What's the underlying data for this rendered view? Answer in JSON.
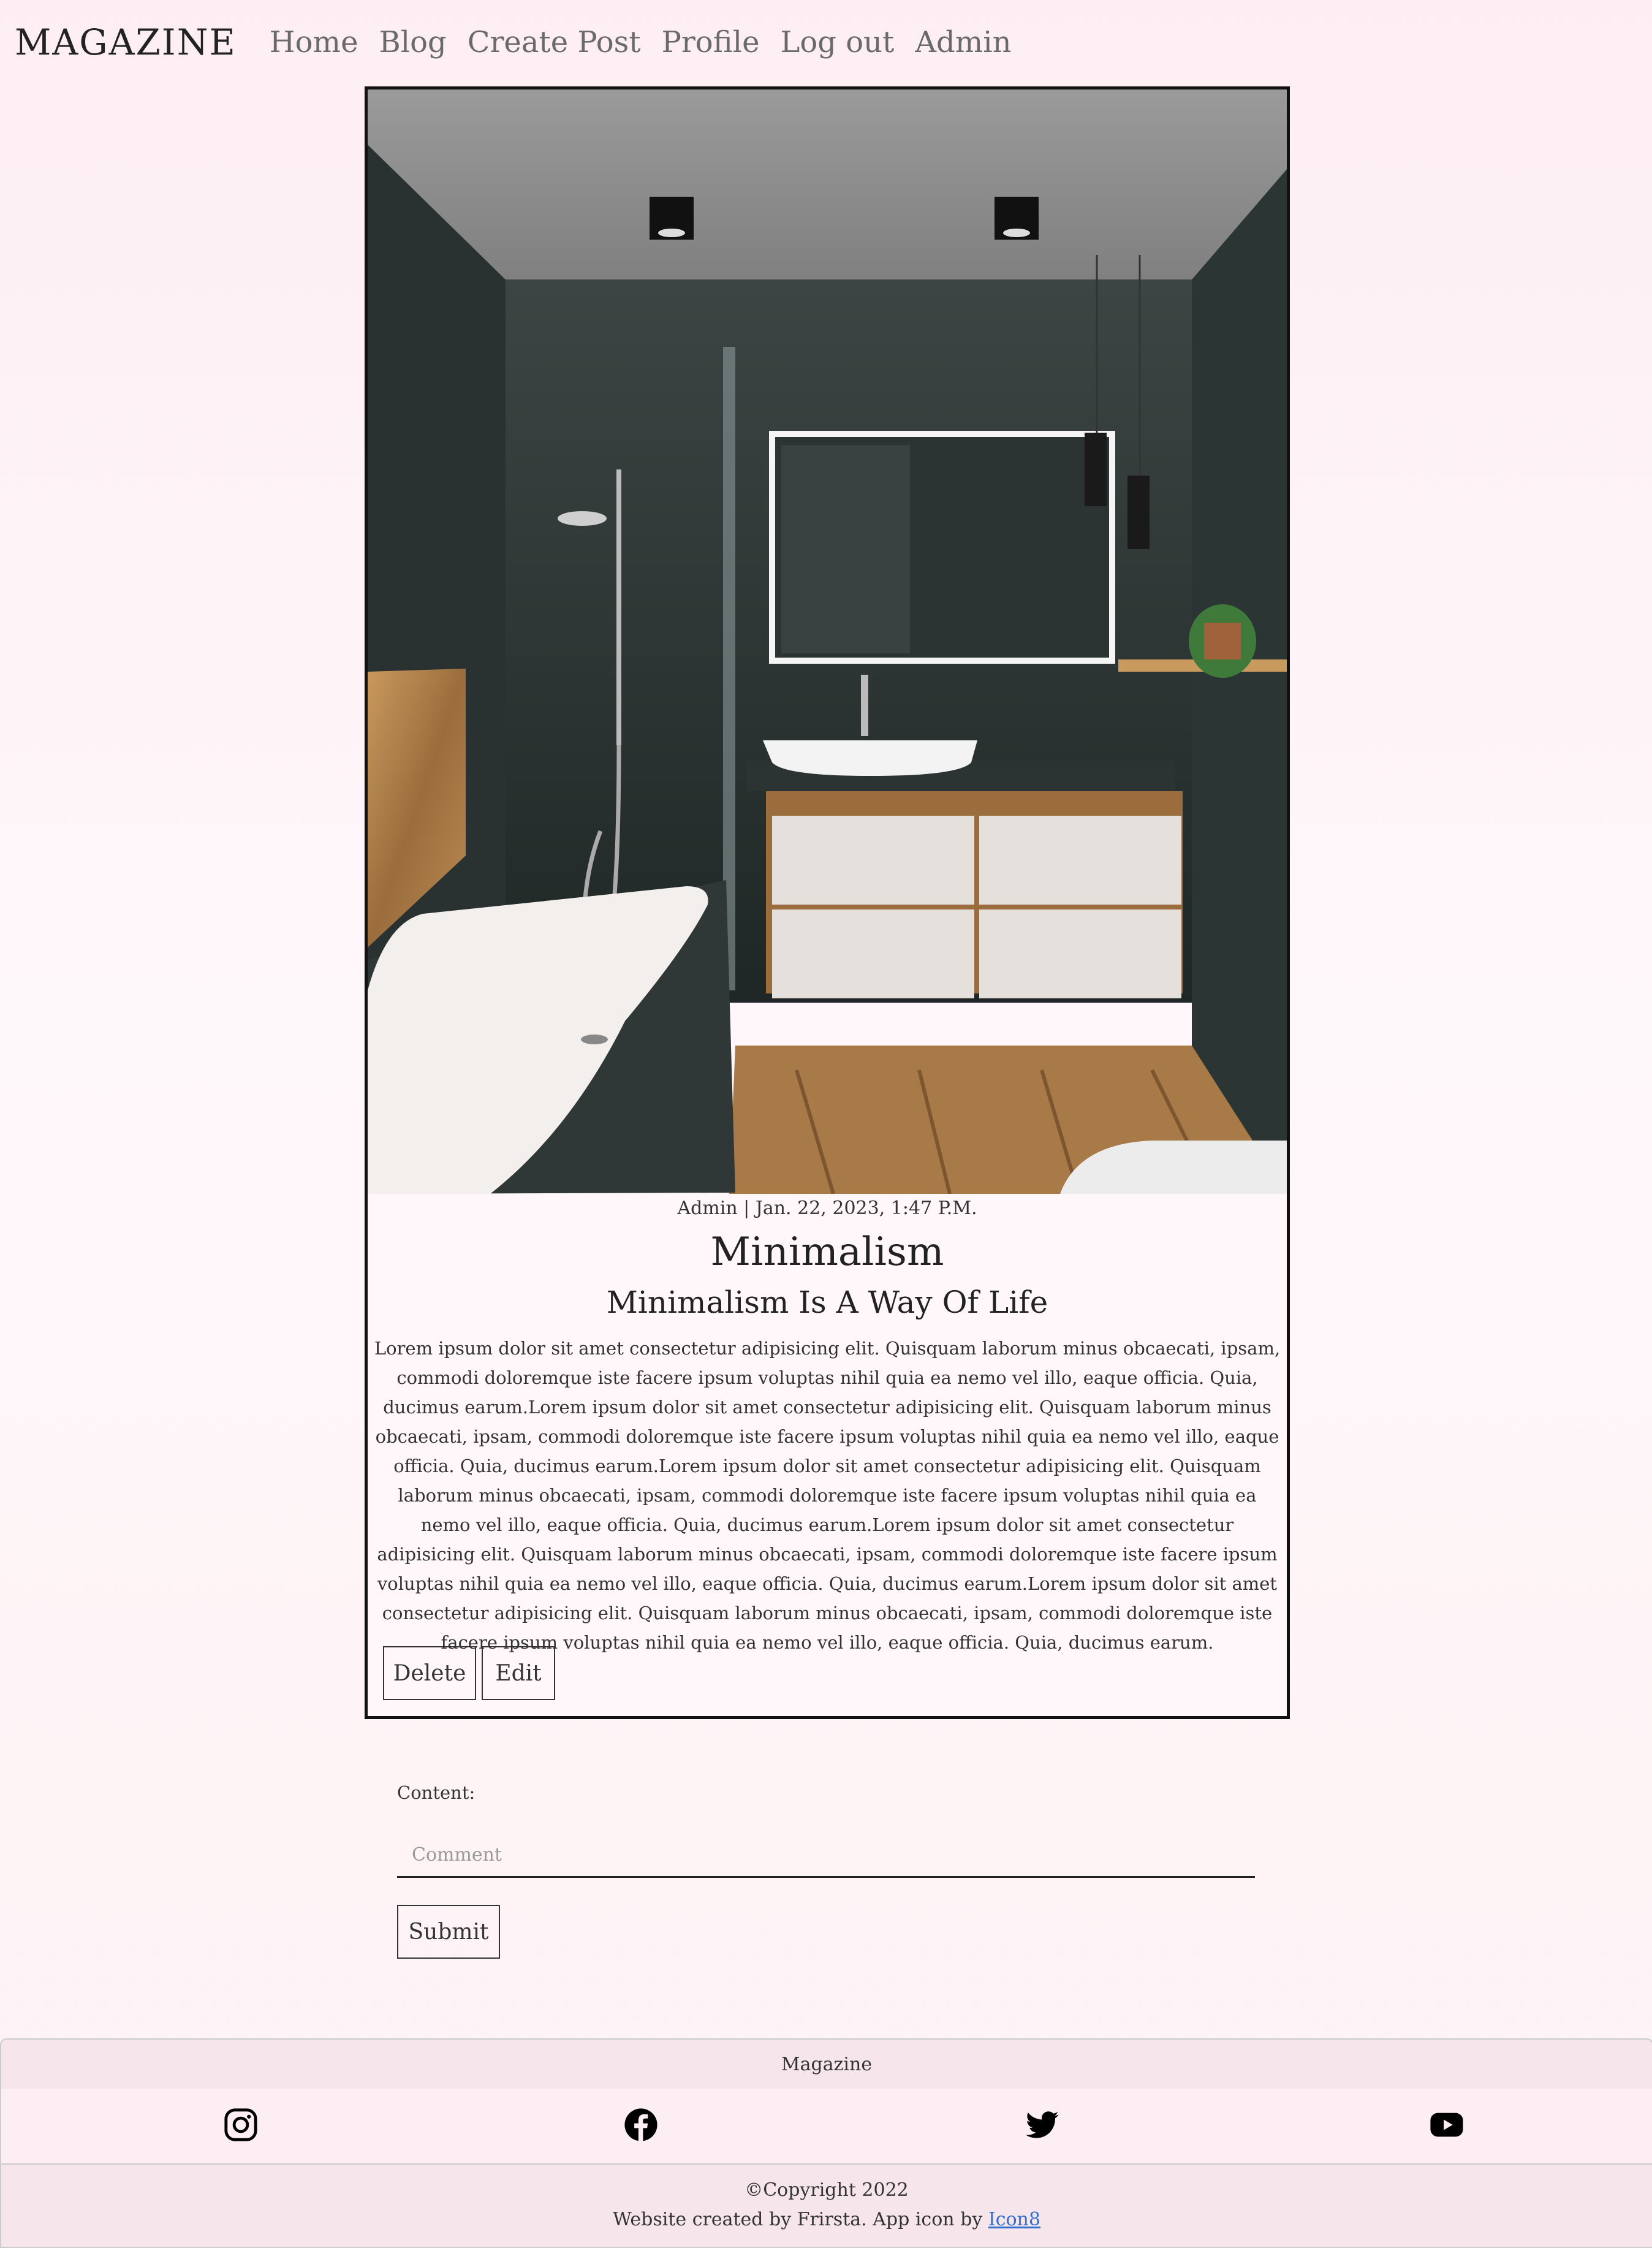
{
  "nav": {
    "brand": "MAGAZINE",
    "links": [
      "Home",
      "Blog",
      "Create Post",
      "Profile",
      "Log out",
      "Admin"
    ]
  },
  "post": {
    "meta": "Admin | Jan. 22, 2023, 1:47 P.M.",
    "title": "Minimalism",
    "subtitle": "Minimalism Is A Way Of Life",
    "body": "Lorem ipsum dolor sit amet consectetur adipisicing elit. Quisquam laborum minus obcaecati, ipsam, commodi doloremque iste facere ipsum voluptas nihil quia ea nemo vel illo, eaque officia. Quia, ducimus earum.Lorem ipsum dolor sit amet consectetur adipisicing elit. Quisquam laborum minus obcaecati, ipsam, commodi doloremque iste facere ipsum voluptas nihil quia ea nemo vel illo, eaque officia. Quia, ducimus earum.Lorem ipsum dolor sit amet consectetur adipisicing elit. Quisquam laborum minus obcaecati, ipsam, commodi doloremque iste facere ipsum voluptas nihil quia ea nemo vel illo, eaque officia. Quia, ducimus earum.Lorem ipsum dolor sit amet consectetur adipisicing elit. Quisquam laborum minus obcaecati, ipsam, commodi doloremque iste facere ipsum voluptas nihil quia ea nemo vel illo, eaque officia. Quia, ducimus earum.Lorem ipsum dolor sit amet consectetur adipisicing elit. Quisquam laborum minus obcaecati, ipsam, commodi doloremque iste facere ipsum voluptas nihil quia ea nemo vel illo, eaque officia. Quia, ducimus earum.",
    "delete_label": "Delete",
    "edit_label": "Edit"
  },
  "comment": {
    "label": "Content:",
    "placeholder": "Comment",
    "submit_label": "Submit"
  },
  "footer": {
    "title": "Magazine",
    "icons": [
      "instagram-icon",
      "facebook-icon",
      "twitter-icon",
      "youtube-icon"
    ],
    "copyright": "©Copyright 2022",
    "credit_prefix": "Website created by Frirsta. App icon by",
    "credit_link": "Icon8"
  },
  "colors": {
    "background": "#fdeef3",
    "link": "#2f6fd0",
    "border": "#111111"
  }
}
